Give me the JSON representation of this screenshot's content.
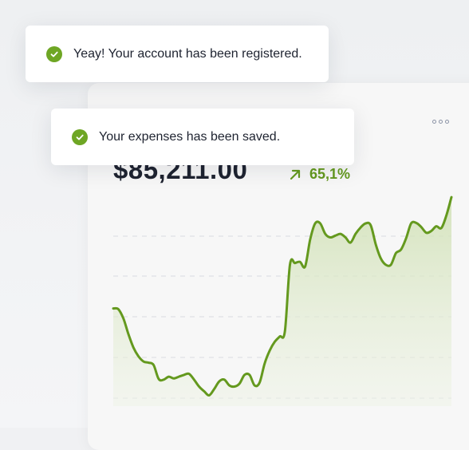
{
  "toasts": [
    {
      "message": "Yeay! Your account has been registered.",
      "icon": "check-circle-icon"
    },
    {
      "message": "Your expenses has been saved.",
      "icon": "check-circle-icon"
    }
  ],
  "summary": {
    "amount": "$85,211.00",
    "change": "65,1%",
    "trend_icon": "arrow-up-right-icon"
  },
  "colors": {
    "accent": "#64991e",
    "check": "#6ea624",
    "text": "#1e2330"
  },
  "chart_data": {
    "type": "area",
    "grid": true,
    "values": [
      0.22,
      0.21,
      0.05,
      -0.22,
      -0.45,
      -0.6,
      -0.69,
      -0.71,
      -0.75,
      -0.99,
      -1.0,
      -0.95,
      -0.98,
      -0.95,
      -0.92,
      -0.9,
      -1.0,
      -1.12,
      -1.2,
      -1.27,
      -1.16,
      -1.03,
      -1.0,
      -1.1,
      -1.12,
      -1.07,
      -0.92,
      -0.92,
      -1.1,
      -1.05,
      -0.72,
      -0.5,
      -0.35,
      -0.26,
      -0.17,
      0.97,
      1.0,
      1.02,
      0.94,
      1.4,
      1.68,
      1.68,
      1.5,
      1.44,
      1.47,
      1.5,
      1.44,
      1.35,
      1.5,
      1.61,
      1.68,
      1.65,
      1.32,
      1.08,
      0.97,
      0.97,
      1.17,
      1.23,
      1.42,
      1.68,
      1.69,
      1.62,
      1.52,
      1.55,
      1.63,
      1.6,
      1.82,
      2.13
    ]
  }
}
